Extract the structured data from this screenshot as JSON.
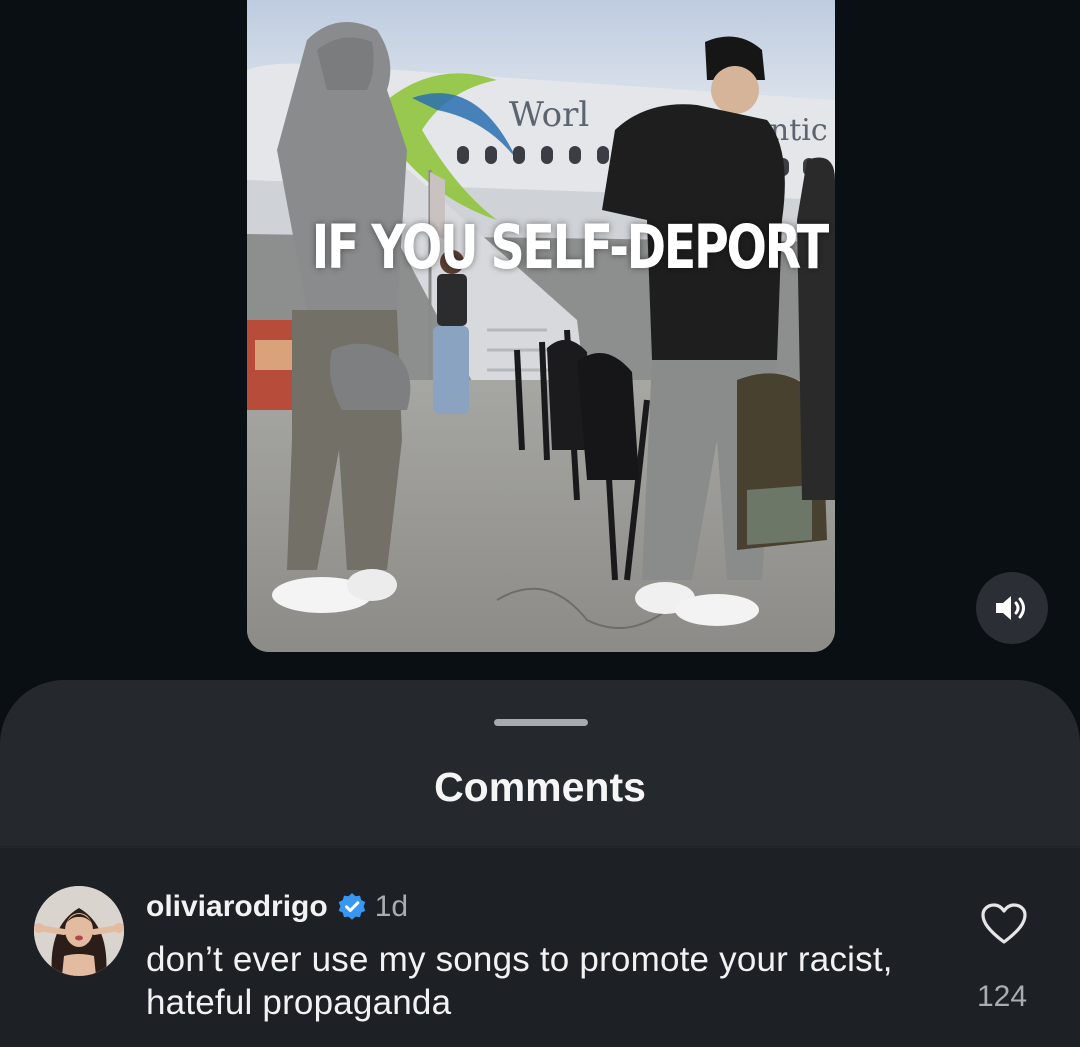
{
  "video": {
    "caption": "IF YOU SELF-DEPORT",
    "mute_icon": "speaker-icon"
  },
  "comments_sheet": {
    "title": "Comments",
    "comments": [
      {
        "username": "oliviarodrigo",
        "verified": true,
        "time": "1d",
        "text": "don’t ever use my songs to promote your racist, hateful propaganda",
        "like_count": "124",
        "like_icon": "heart-icon"
      }
    ]
  },
  "colors": {
    "background": "#0a0f14",
    "sheet": "#25282d",
    "comment_row": "#1d2025",
    "verified_badge": "#3897f0"
  }
}
